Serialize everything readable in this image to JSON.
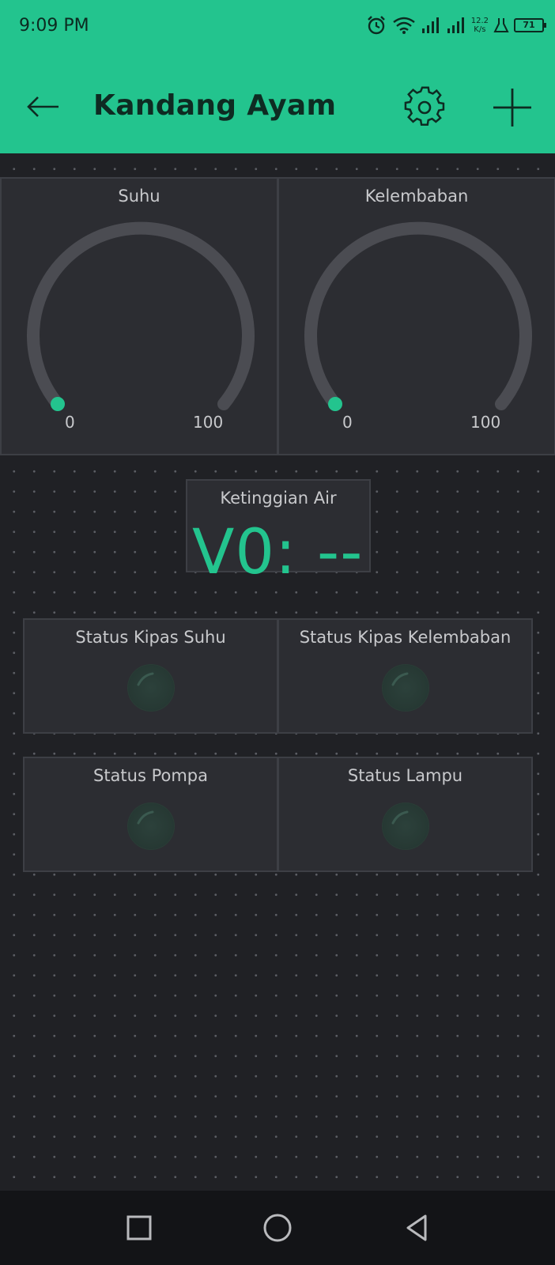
{
  "status_bar": {
    "time": "9:09 PM",
    "net_speed_value": "12.2",
    "net_speed_unit": "K/s",
    "battery": "71",
    "icons": [
      "alarm-icon",
      "wifi-icon",
      "signal-icon",
      "signal-icon",
      "lab-icon",
      "battery-icon"
    ]
  },
  "header": {
    "title": "Kandang Ayam",
    "back_icon": "arrow-left-icon",
    "settings_icon": "gear-icon",
    "add_icon": "plus-icon"
  },
  "widgets": {
    "gauge_suhu": {
      "title": "Suhu",
      "min": "0",
      "max": "100"
    },
    "gauge_kelembaban": {
      "title": "Kelembaban",
      "min": "0",
      "max": "100"
    },
    "ketinggian_air": {
      "title": "Ketinggian Air",
      "value": "V0: --"
    },
    "leds": [
      {
        "title": "Status Kipas Suhu"
      },
      {
        "title": "Status Kipas Kelembaban"
      },
      {
        "title": "Status Pompa"
      },
      {
        "title": "Status Lampu"
      }
    ]
  },
  "nav": {
    "icons": [
      "recents-square-icon",
      "home-circle-icon",
      "back-triangle-icon"
    ]
  },
  "colors": {
    "accent": "#23c48e",
    "background": "#202125",
    "widget": "#2c2d32",
    "gauge_track": "#4b4c52"
  }
}
